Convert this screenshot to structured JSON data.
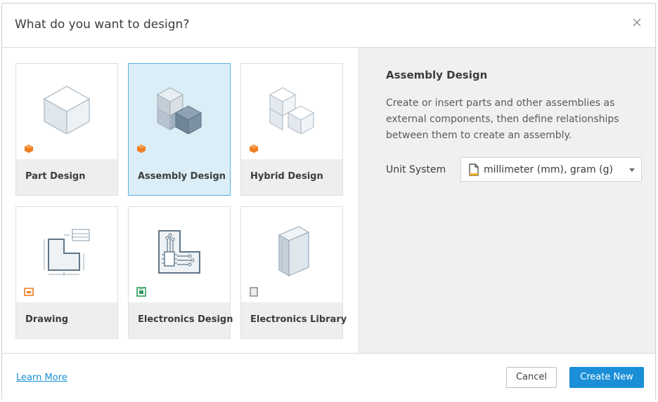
{
  "dialog": {
    "title": "What do you want to design?",
    "close_icon": "close-icon"
  },
  "cards": [
    {
      "label": "Part Design",
      "icon": "cube-icon",
      "badge": "part-badge-icon",
      "selected": false
    },
    {
      "label": "Assembly Design",
      "icon": "assembly-icon",
      "badge": "assembly-badge-icon",
      "selected": true
    },
    {
      "label": "Hybrid Design",
      "icon": "hybrid-icon",
      "badge": "hybrid-badge-icon",
      "selected": false
    },
    {
      "label": "Drawing",
      "icon": "drawing-icon",
      "badge": "drawing-badge-icon",
      "selected": false
    },
    {
      "label": "Electronics Design",
      "icon": "circuit-board-icon",
      "badge": "electronics-badge-icon",
      "selected": false
    },
    {
      "label": "Electronics Library",
      "icon": "book-icon",
      "badge": "library-badge-icon",
      "selected": false
    }
  ],
  "detail": {
    "title": "Assembly Design",
    "description": "Create or insert parts and other assemblies as external components, then define relationships between them to create an assembly.",
    "unit_label": "Unit System",
    "unit_value": "millimeter (mm), gram (g)"
  },
  "footer": {
    "learn_more": "Learn More",
    "cancel": "Cancel",
    "create": "Create New"
  },
  "colors": {
    "accent": "#1a8fd8",
    "selected_bg": "#dbeef8",
    "badge_orange": "#f07d1e",
    "badge_green": "#2e9e5b"
  }
}
